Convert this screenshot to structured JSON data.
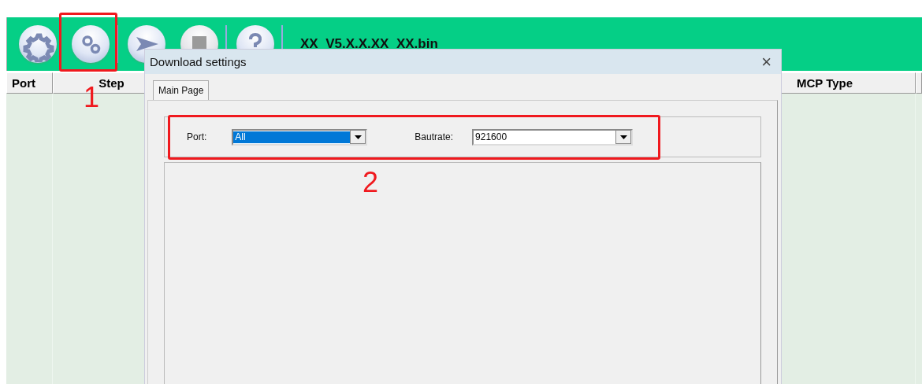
{
  "toolbar": {
    "buttons": [
      {
        "kind": "gear",
        "disabled": false
      },
      {
        "kind": "gears",
        "disabled": false
      },
      {
        "kind": "send",
        "disabled": false
      },
      {
        "kind": "stop",
        "disabled": true
      },
      {
        "kind": "help",
        "disabled": false
      }
    ],
    "file_name": "XX_V5.X.X.XX_XX.bin"
  },
  "table": {
    "columns": [
      "Port",
      "Step",
      "MCP Type"
    ]
  },
  "dialog": {
    "title": "Download settings",
    "close": "×",
    "tabs": [
      {
        "label": "Main Page",
        "selected": true
      }
    ],
    "fields": [
      {
        "label": "Port:",
        "value": "All",
        "highlighted": true
      },
      {
        "label": "Bautrate:",
        "value": "921600",
        "highlighted": false
      }
    ]
  },
  "annotations": [
    {
      "label": "1"
    },
    {
      "label": "2"
    }
  ]
}
